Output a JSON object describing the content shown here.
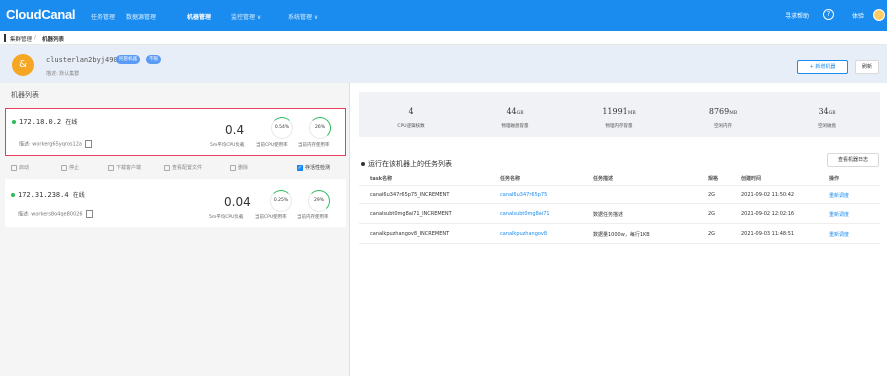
{
  "nav": {
    "logo": "CloudCanal",
    "items": [
      "任务管理",
      "数据源管理",
      "机器管理",
      "监控管理 ∨",
      "系统管理 ∨"
    ],
    "help": "寻求帮助",
    "user": "体验"
  },
  "breadcrumb": [
    "集群管理",
    "/",
    "机器列表"
  ],
  "cluster": {
    "name": "clusterlan2byj490",
    "tags": [
      "托管机器",
      "不限"
    ],
    "desc": "描述: 默认集群"
  },
  "actions": {
    "add": "+ 新增机器",
    "refresh": "刷新"
  },
  "left_title": "机器列表",
  "machines": [
    {
      "ip": "172.18.0.2",
      "status": "在线",
      "desc": "描述: workerg65yqros12a",
      "load": "0.4",
      "cpu": "0.54%",
      "mem": "26%",
      "cpu_frac": 0.0054,
      "mem_frac": 0.26
    },
    {
      "ip": "172.31.238.4",
      "status": "在线",
      "desc": "描述: workers8o4qe80026",
      "load": "0.04",
      "cpu": "0.25%",
      "mem": "29%",
      "cpu_frac": 0.0025,
      "mem_frac": 0.29
    }
  ],
  "metric_labels": [
    "5m平均CPU负载",
    "当前CPU使用率",
    "当前内存使用率"
  ],
  "toolbar": [
    "启动",
    "停止",
    "下载客户端",
    "查看配置文件",
    "删除",
    "存活性检测"
  ],
  "stats": [
    {
      "v": "4",
      "u": "",
      "l": "CPU逻辑核数"
    },
    {
      "v": "44",
      "u": "GB",
      "l": "物理磁盘容量"
    },
    {
      "v": "11991",
      "u": "MB",
      "l": "物理内存容量"
    },
    {
      "v": "8769",
      "u": "MB",
      "l": "空闲内存"
    },
    {
      "v": "34",
      "u": "GB",
      "l": "空闲磁盘"
    }
  ],
  "logs_btn": "查看机器日志",
  "task_title": "运行在该机器上的任务列表",
  "table": {
    "headers": [
      "task名称",
      "任务名称",
      "任务描述",
      "规格",
      "创建时间",
      "操作"
    ],
    "rows": [
      [
        "canal6u347r65p75_INCREMENT",
        "canal6u347r65p75",
        "",
        "2G",
        "2021-09-02 11:50:42",
        "重新调度"
      ],
      [
        "canalsubt0mg8ai71_INCREMENT",
        "canalsubt0mg8ai71",
        "数据任务描述",
        "2G",
        "2021-09-02 12:02:16",
        "重新调度"
      ],
      [
        "canalkpuzhangov8_INCREMENT",
        "canalkpuzhangov8",
        "数据量1000w，每行1KB",
        "2G",
        "2021-09-03 11:48:51",
        "重新调度"
      ]
    ]
  },
  "colors": {
    "primary": "#1a8cf0",
    "online": "#2bbd5a",
    "selected_border": "#e53e5e"
  }
}
